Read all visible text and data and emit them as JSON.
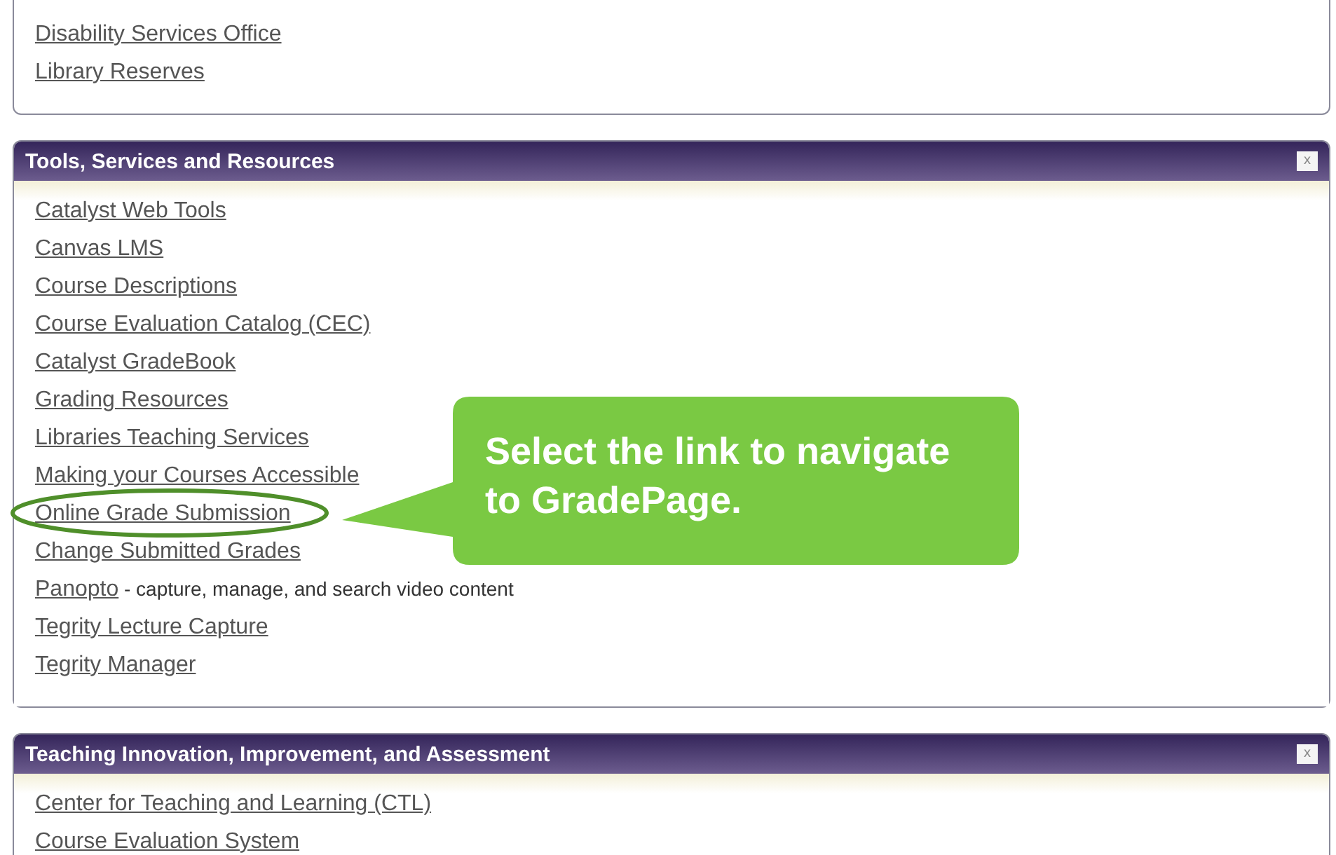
{
  "panels": [
    {
      "links": [
        {
          "text": "Disability Services Office"
        },
        {
          "text": "Library Reserves"
        }
      ]
    },
    {
      "title": "Tools, Services and Resources",
      "close_label": "x",
      "links": [
        {
          "text": "Catalyst Web Tools"
        },
        {
          "text": "Canvas LMS"
        },
        {
          "text": "Course Descriptions"
        },
        {
          "text": "Course Evaluation Catalog (CEC)"
        },
        {
          "text": "Catalyst GradeBook"
        },
        {
          "text": "Grading Resources"
        },
        {
          "text": "Libraries Teaching Services"
        },
        {
          "text": "Making your Courses Accessible"
        },
        {
          "text": "Online Grade Submission"
        },
        {
          "text": "Change Submitted Grades"
        },
        {
          "text": "Panopto",
          "note": " - capture, manage, and search video content"
        },
        {
          "text": "Tegrity Lecture Capture"
        },
        {
          "text": "Tegrity Manager"
        }
      ],
      "callout": {
        "text": "Select the link to navigate to GradePage."
      }
    },
    {
      "title": "Teaching Innovation, Improvement, and Assessment",
      "close_label": "x",
      "links": [
        {
          "text": "Center for Teaching and Learning (CTL)"
        },
        {
          "text": "Course Evaluation System"
        }
      ]
    }
  ]
}
